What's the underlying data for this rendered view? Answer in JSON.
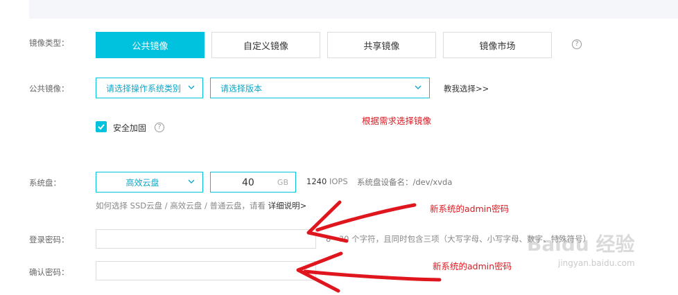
{
  "image_type": {
    "label": "镜像类型：",
    "options": [
      "公共镜像",
      "自定义镜像",
      "共享镜像",
      "镜像市场"
    ],
    "selected": "公共镜像",
    "help": "?"
  },
  "public_image": {
    "label": "公共镜像：",
    "os_select": "请选择操作系统类别",
    "version_select": "请选择版本",
    "help_link": "教我选择>>"
  },
  "annotation_image": "根据需求选择镜像",
  "security": {
    "label": "安全加固",
    "checked": true,
    "help": "?"
  },
  "system_disk": {
    "label": "系统盘：",
    "type_select": "高效云盘",
    "size_value": "40",
    "size_unit": "GB",
    "iops_value": "1240",
    "iops_unit": "IOPS",
    "device_label": "系统盘设备名：/dev/xvda",
    "hint_prefix": "如何选择 SSD云盘 / 高效云盘 / 普通云盘，请看",
    "hint_link": "详细说明>"
  },
  "login_password": {
    "label": "登录密码：",
    "hint": "8 - 30 个字符，且同时包含三项（大写字母、小写字母、数字、特殊符号）"
  },
  "confirm_password": {
    "label": "确认密码："
  },
  "annotation_admin_1": "新系统的admin密码",
  "annotation_admin_2": "新系统的admin密码",
  "watermark": {
    "brand": "Baidu 经验",
    "url": "jingyan.baidu.com"
  },
  "colors": {
    "accent": "#00c1de",
    "annotation_red": "#e0161e"
  }
}
